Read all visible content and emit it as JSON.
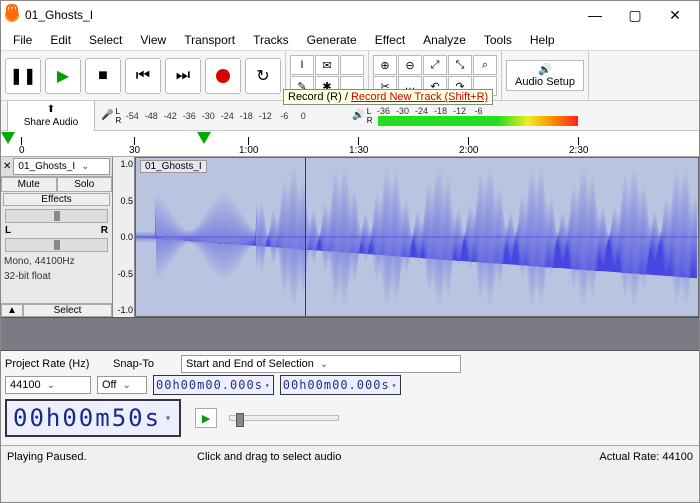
{
  "window": {
    "title": "01_Ghosts_I"
  },
  "menu": {
    "items": [
      "File",
      "Edit",
      "Select",
      "View",
      "Transport",
      "Tracks",
      "Generate",
      "Effect",
      "Analyze",
      "Tools",
      "Help"
    ]
  },
  "toolbar": {
    "tooltip_a": "Record (R) / ",
    "tooltip_b": "Record New Track (Shift+R)",
    "audio_setup_label": "Audio Setup"
  },
  "share": {
    "label": "Share Audio"
  },
  "meter": {
    "rec_ticks": [
      "-54",
      "-48",
      "-42",
      "-36",
      "-30",
      "-24",
      "-18",
      "-12",
      "-6",
      "0"
    ],
    "play_ticks": [
      "-36",
      "-30",
      "-24",
      "-18",
      "-12",
      "-6"
    ]
  },
  "timeline": {
    "ticks": [
      {
        "pos": 18,
        "label": "0"
      },
      {
        "pos": 128,
        "label": "30"
      },
      {
        "pos": 238,
        "label": "1:00"
      },
      {
        "pos": 348,
        "label": "1:30"
      },
      {
        "pos": 458,
        "label": "2:00"
      },
      {
        "pos": 568,
        "label": "2:30"
      }
    ]
  },
  "track": {
    "name_dropdown": "01_Ghosts_I",
    "clip_label": "01_Ghosts_I",
    "mute": "Mute",
    "solo": "Solo",
    "effects": "Effects",
    "l": "L",
    "r": "R",
    "format_line1": "Mono, 44100Hz",
    "format_line2": "32-bit float",
    "select": "Select",
    "yscale": [
      "1.0",
      "0.5",
      "0.0",
      "-0.5",
      "-1.0"
    ]
  },
  "selection": {
    "project_rate_label": "Project Rate (Hz)",
    "snap_label": "Snap-To",
    "range_label": "Start and End of Selection",
    "project_rate": "44100",
    "snap": "Off",
    "time_a": "00h00m00.000s",
    "time_b": "00h00m00.000s",
    "bigtime": "00h00m50s"
  },
  "status": {
    "left": "Playing Paused.",
    "mid": "Click and drag to select audio",
    "right": "Actual Rate: 44100"
  },
  "icons": {
    "pause": "❚❚",
    "play": "▶",
    "stop": "■",
    "skip_start": "⏮",
    "skip_end": "⏭",
    "loop": "↻",
    "ibeam": "I",
    "env": "✉",
    "draw": "✎",
    "multi": "✱",
    "zoom_in": "⊕",
    "zoom_out": "⊖",
    "fit_sel": "⤢",
    "fit_proj": "⤡",
    "zoom_tog": "⌕",
    "trim": "✂",
    "sil": "…",
    "speaker": "🔊",
    "mic": "🎤",
    "up": "⬆",
    "close": "✕",
    "min": "—",
    "max": "▢",
    "collapse": "▲"
  }
}
